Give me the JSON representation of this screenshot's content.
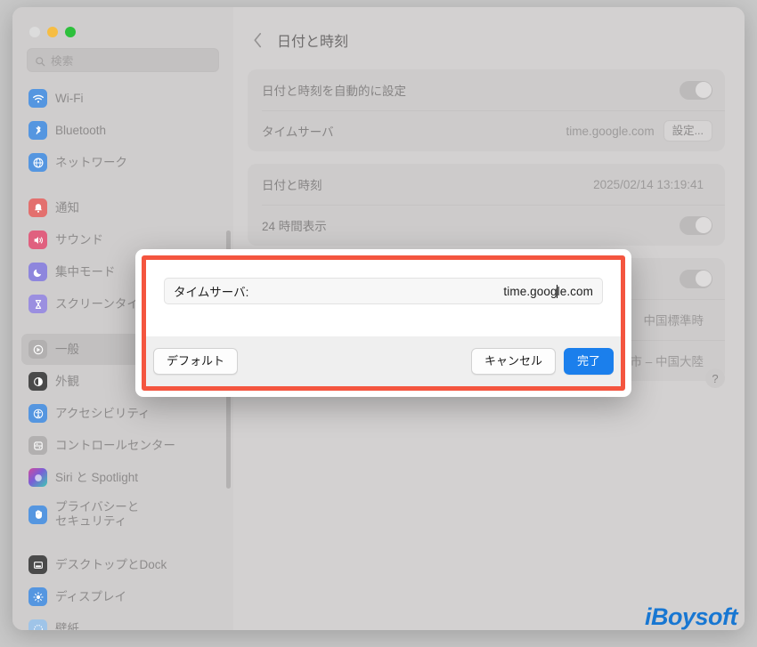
{
  "window": {
    "traffic_lights": [
      "close",
      "minimize",
      "maximize"
    ]
  },
  "search": {
    "placeholder": "検索",
    "icon": "search-icon"
  },
  "sidebar": {
    "groups": [
      {
        "items": [
          {
            "label": "Wi-Fi",
            "icon": "wifi-icon",
            "color": "#5596e0",
            "selected": false
          },
          {
            "label": "Bluetooth",
            "icon": "bluetooth-icon",
            "color": "#5596e0",
            "selected": false
          },
          {
            "label": "ネットワーク",
            "icon": "globe-icon",
            "color": "#5596e0",
            "selected": false
          }
        ]
      },
      {
        "items": [
          {
            "label": "通知",
            "icon": "bell-icon",
            "color": "#e3706e",
            "selected": false
          },
          {
            "label": "サウンド",
            "icon": "speaker-icon",
            "color": "#e0607f",
            "selected": false
          },
          {
            "label": "集中モード",
            "icon": "moon-icon",
            "color": "#8e86dd",
            "selected": false
          },
          {
            "label": "スクリーンタイム",
            "icon": "hourglass-icon",
            "color": "#9b8fe0",
            "selected": false
          }
        ]
      },
      {
        "items": [
          {
            "label": "一般",
            "icon": "gear-icon",
            "color": "#b2b0b0",
            "selected": true
          },
          {
            "label": "外観",
            "icon": "appearance-icon",
            "color": "#4a4a4a",
            "selected": false
          },
          {
            "label": "アクセシビリティ",
            "icon": "accessibility-icon",
            "color": "#5596e0",
            "selected": false
          },
          {
            "label": "コントロールセンター",
            "icon": "control-center-icon",
            "color": "#b2b0b0",
            "selected": false
          },
          {
            "label": "Siri と Spotlight",
            "icon": "siri-icon",
            "color": "#9a6fb0",
            "selected": false
          },
          {
            "label": "プライバシーと\nセキュリティ",
            "icon": "hand-icon",
            "color": "#5596e0",
            "selected": false,
            "two_line": true
          }
        ]
      },
      {
        "items": [
          {
            "label": "デスクトップとDock",
            "icon": "desktop-dock-icon",
            "color": "#4a4a4a",
            "selected": false
          },
          {
            "label": "ディスプレイ",
            "icon": "display-icon",
            "color": "#5596e0",
            "selected": false
          },
          {
            "label": "壁紙",
            "icon": "wallpaper-icon",
            "color": "#9fc4e8",
            "selected": false
          }
        ]
      }
    ]
  },
  "main": {
    "back_icon": "chevron-left-icon",
    "title": "日付と時刻",
    "groups": [
      {
        "rows": [
          {
            "label": "日付と時刻を自動的に設定",
            "control": "toggle",
            "value": ""
          },
          {
            "label": "タイムサーバ",
            "control": "button",
            "value": "time.google.com",
            "button_label": "設定..."
          }
        ]
      },
      {
        "rows": [
          {
            "label": "日付と時刻",
            "control": "text",
            "value": "2025/02/14 13:19:41"
          },
          {
            "label": "24 時間表示",
            "control": "toggle",
            "value": ""
          }
        ]
      },
      {
        "rows": [
          {
            "label": "",
            "control": "toggle",
            "value": ""
          },
          {
            "label": "",
            "control": "text",
            "value": "中国標準時"
          },
          {
            "label": "",
            "control": "text",
            "value": "上海市 – 中国大陸"
          }
        ]
      }
    ],
    "help_label": "?"
  },
  "dialog": {
    "field_label": "タイムサーバ:",
    "field_value_before_caret": "time.goog",
    "field_value_after_caret": "le.com",
    "field_value_full": "time.google.com",
    "buttons": {
      "default_label": "デフォルト",
      "cancel_label": "キャンセル",
      "done_label": "完了"
    },
    "highlight_color": "#f4553f"
  },
  "watermark": {
    "text": "iBoysoft",
    "color": "#1877d2"
  }
}
